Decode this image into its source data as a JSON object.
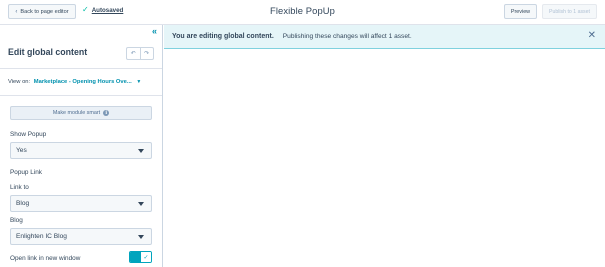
{
  "topbar": {
    "back_label": "Back to page editor",
    "autosave_label": "Autosaved",
    "title": "Flexible PopUp",
    "preview_label": "Preview",
    "publish_label": "Publish to 1 asset"
  },
  "sidebar": {
    "title": "Edit global content",
    "view_on_label": "View on:",
    "view_on_value": "Marketplace - Opening Hours Ove...",
    "smart_button_label": "Make module smart",
    "show_popup_label": "Show Popup",
    "show_popup_value": "Yes",
    "popup_link_label": "Popup Link",
    "link_to_label": "Link to",
    "link_to_value": "Blog",
    "blog_label": "Blog",
    "blog_value": "Enlighten IC Blog",
    "new_window_label": "Open link in new window",
    "new_window_enabled": true
  },
  "banner": {
    "bold_text": "You are editing global content.",
    "text": "Publishing these changes will affect 1 asset."
  },
  "colors": {
    "accent": "#00a4bd",
    "link": "#0091ae",
    "banner_bg": "#e5f5f8",
    "text": "#33475b"
  },
  "icons": [
    "chevron-left-icon",
    "check-icon",
    "double-chevron-left-icon",
    "undo-icon",
    "redo-icon",
    "caret-down-icon",
    "info-icon",
    "close-icon"
  ]
}
